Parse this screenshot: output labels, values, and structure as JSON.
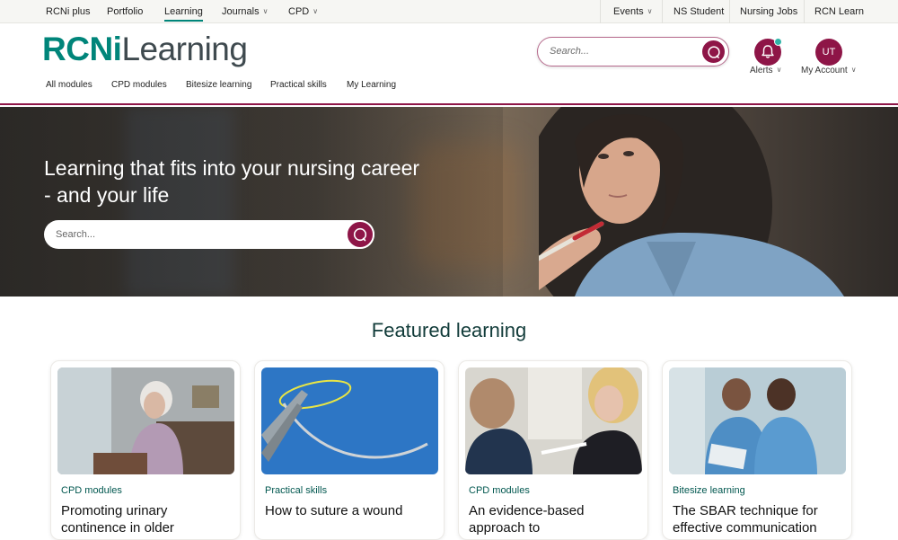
{
  "topnav": {
    "left": [
      {
        "label": "RCNi plus",
        "caret": false
      },
      {
        "label": "Portfolio",
        "caret": false
      },
      {
        "label": "Learning",
        "caret": false,
        "active": true
      },
      {
        "label": "Journals",
        "caret": true
      },
      {
        "label": "CPD",
        "caret": true
      }
    ],
    "right": [
      {
        "label": "Events",
        "caret": true
      },
      {
        "label": "NS Student",
        "caret": false
      },
      {
        "label": "Nursing Jobs",
        "caret": false
      },
      {
        "label": "RCN Learn",
        "caret": false
      }
    ]
  },
  "header": {
    "logo_part1": "RCNi",
    "logo_part2": "Learning",
    "search_placeholder": "Search...",
    "alerts_label": "Alerts",
    "account_initials": "UT",
    "account_label": "My Account"
  },
  "subnav": [
    "All modules",
    "CPD modules",
    "Bitesize learning",
    "Practical skills",
    "My Learning"
  ],
  "hero": {
    "headline": "Learning that fits into your nursing career - and your life",
    "search_placeholder": "Search..."
  },
  "featured": {
    "heading": "Featured learning",
    "cards": [
      {
        "category": "CPD modules",
        "title": "Promoting urinary continence in older"
      },
      {
        "category": "Practical skills",
        "title": "How to suture a wound"
      },
      {
        "category": "CPD modules",
        "title": "An evidence-based approach to"
      },
      {
        "category": "Bitesize learning",
        "title": "The SBAR technique for effective communication"
      }
    ]
  },
  "colors": {
    "brand_teal": "#00857a",
    "brand_plum": "#8e1547",
    "heading": "#123c3a"
  }
}
